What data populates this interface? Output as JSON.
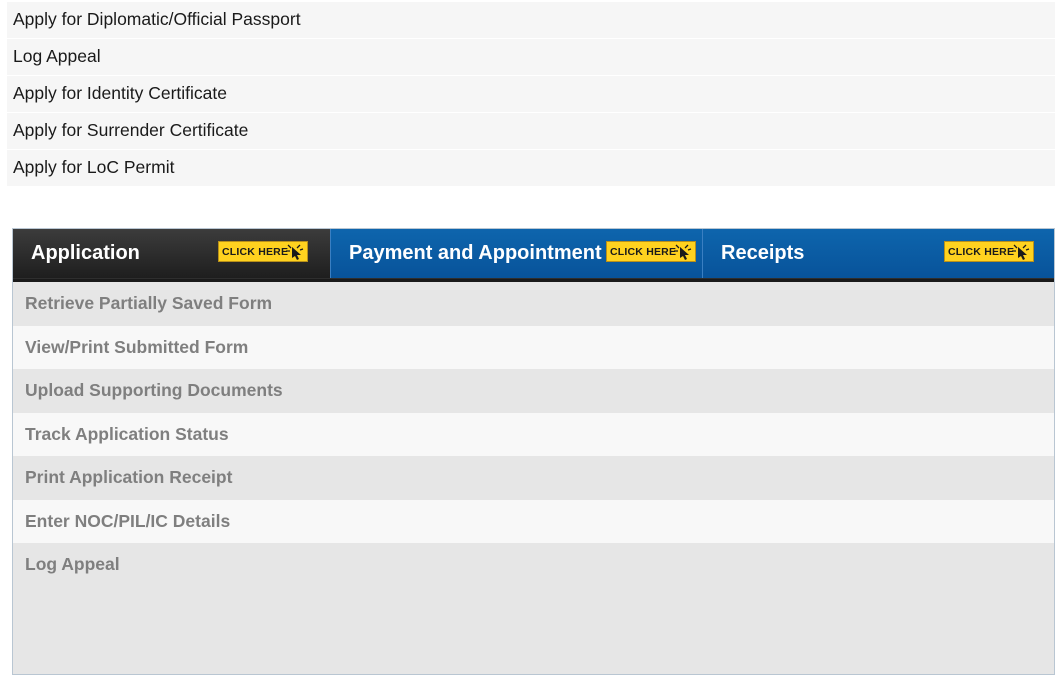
{
  "service_links": [
    "Apply for Diplomatic/Official Passport",
    "Log Appeal",
    "Apply for Identity Certificate",
    "Apply for Surrender Certificate",
    "Apply for LoC Permit"
  ],
  "tabs": {
    "application": {
      "label": "Application",
      "badge": "CLICK HERE"
    },
    "payment": {
      "label": "Payment and Appointment",
      "badge": "CLICK HERE"
    },
    "receipts": {
      "label": "Receipts",
      "badge": "CLICK HERE"
    }
  },
  "application_menu": [
    "Retrieve Partially Saved Form",
    "View/Print Submitted Form",
    "Upload Supporting Documents",
    "Track Application Status",
    "Print Application Receipt",
    "Enter NOC/PIL/IC Details",
    "Log Appeal"
  ],
  "colors": {
    "active_tab": "#2b2b2b",
    "inactive_tab": "#0b5ea6",
    "badge": "#ffd21f",
    "menu_text": "#7f7f7f"
  }
}
